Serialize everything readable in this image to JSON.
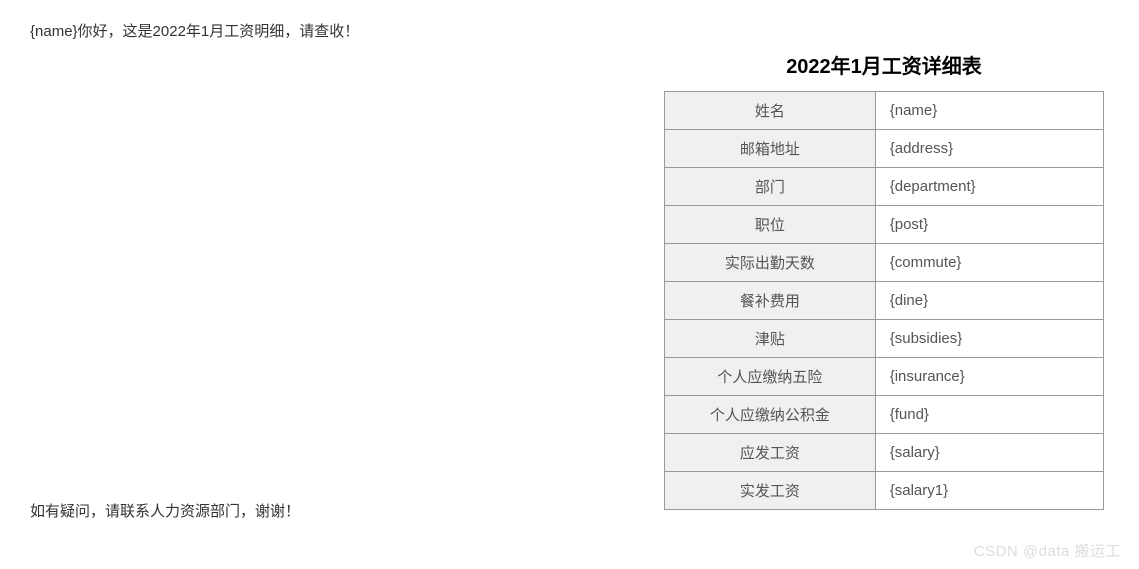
{
  "greeting": "{name}你好，这是2022年1月工资明细，请查收！",
  "table": {
    "title": "2022年1月工资详细表",
    "rows": [
      {
        "label": "姓名",
        "value": "{name}"
      },
      {
        "label": "邮箱地址",
        "value": "{address}"
      },
      {
        "label": "部门",
        "value": "{department}"
      },
      {
        "label": "职位",
        "value": "{post}"
      },
      {
        "label": "实际出勤天数",
        "value": "{commute}"
      },
      {
        "label": "餐补费用",
        "value": "{dine}"
      },
      {
        "label": "津贴",
        "value": "{subsidies}"
      },
      {
        "label": "个人应缴纳五险",
        "value": "{insurance}"
      },
      {
        "label": "个人应缴纳公积金",
        "value": "{fund}"
      },
      {
        "label": "应发工资",
        "value": "{salary}"
      },
      {
        "label": "实发工资",
        "value": "{salary1}"
      }
    ]
  },
  "footer": "如有疑问，请联系人力资源部门，谢谢！",
  "watermark": "CSDN @data 搬运工"
}
